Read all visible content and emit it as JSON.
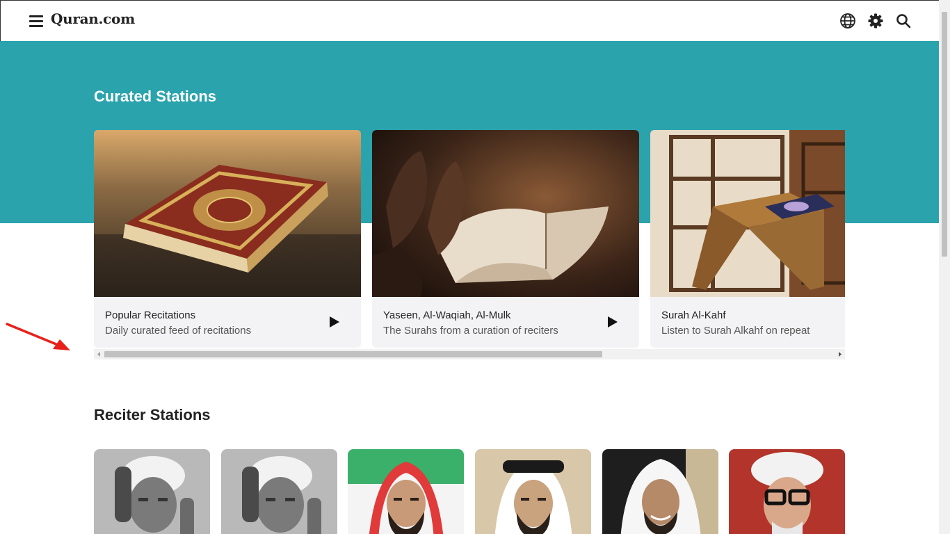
{
  "header": {
    "logo": "Quran.com",
    "menu_icon": "hamburger-menu-icon",
    "language_icon": "globe-icon",
    "settings_icon": "gear-icon",
    "search_icon": "search-icon"
  },
  "curated": {
    "title": "Curated Stations",
    "cards": [
      {
        "title": "Popular Recitations",
        "subtitle": "Daily curated feed of recitations",
        "icon": "play-icon"
      },
      {
        "title": "Yaseen, Al-Waqiah, Al-Mulk",
        "subtitle": "The Surahs from a curation of reciters",
        "icon": "play-icon"
      },
      {
        "title": "Surah Al-Kahf",
        "subtitle": "Listen to Surah Alkahf on repeat",
        "icon": "play-icon"
      }
    ]
  },
  "reciters": {
    "title": "Reciter Stations",
    "count_visible": 6
  },
  "colors": {
    "accent": "#2aa3ad",
    "annotation": "#e8201b"
  }
}
